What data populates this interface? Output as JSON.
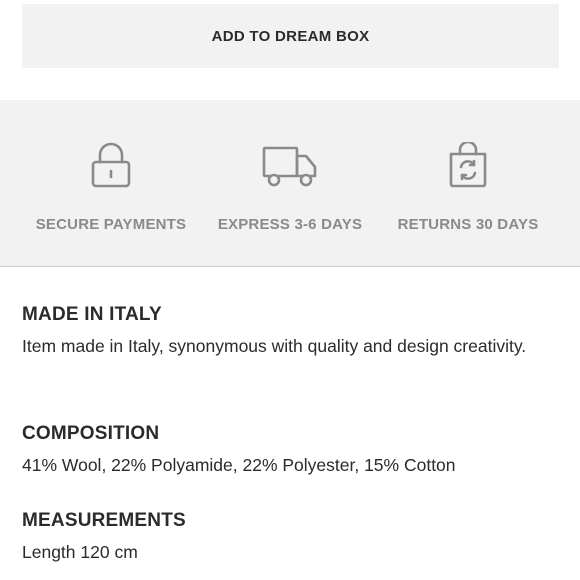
{
  "add_button": {
    "label": "ADD TO DREAM BOX"
  },
  "features": [
    {
      "label": "SECURE PAYMENTS",
      "icon": "lock-icon"
    },
    {
      "label": "EXPRESS 3-6 DAYS",
      "icon": "truck-icon"
    },
    {
      "label": "RETURNS 30 DAYS",
      "icon": "return-bag-icon"
    }
  ],
  "details": {
    "made_in": {
      "title": "MADE IN ITALY",
      "text": "Item made in Italy, synonymous with quality and design creativity."
    },
    "composition": {
      "title": "COMPOSITION",
      "text": "41% Wool, 22% Polyamide, 22% Polyester, 15% Cotton"
    },
    "measurements": {
      "title": "MEASUREMENTS",
      "text": "Length 120 cm"
    }
  },
  "colors": {
    "panel_bg": "#f2f2f2",
    "icon_gray": "#8a8a8a",
    "text": "#2b2b2b"
  }
}
